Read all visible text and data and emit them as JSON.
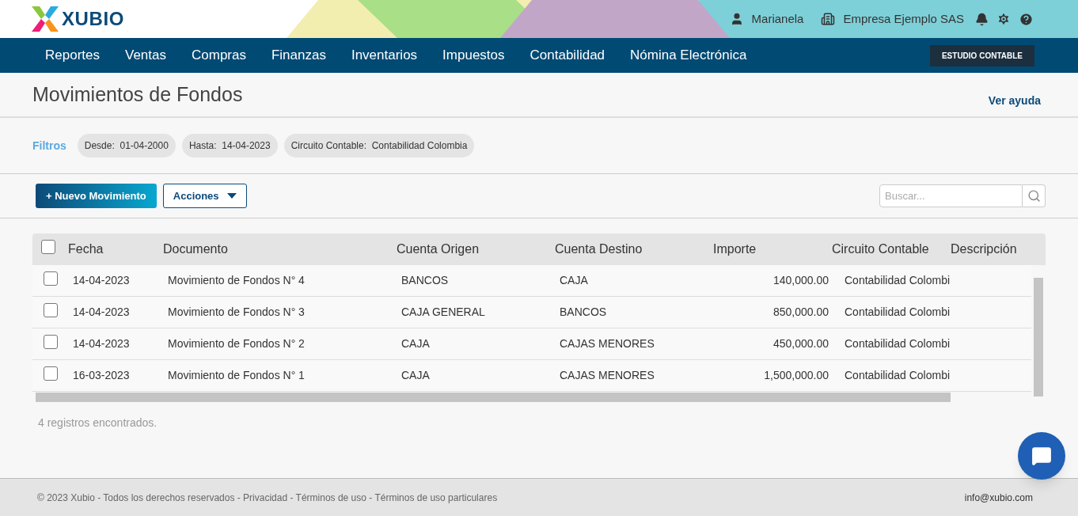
{
  "header": {
    "logo": "XUBIO",
    "user": "Marianela",
    "company": "Empresa Ejemplo SAS"
  },
  "nav": {
    "items": [
      {
        "label": "Reportes",
        "selected": false
      },
      {
        "label": "Ventas",
        "selected": false
      },
      {
        "label": "Compras",
        "selected": false
      },
      {
        "label": "Finanzas",
        "selected": false
      },
      {
        "label": "Inventarios",
        "selected": false
      },
      {
        "label": "Impuestos",
        "selected": false
      },
      {
        "label": "Contabilidad",
        "selected": false
      },
      {
        "label": "Nómina Electrónica",
        "selected": false
      }
    ],
    "badge": "ESTUDIO CONTABLE"
  },
  "page": {
    "title": "Movimientos de Fondos",
    "help_link": "Ver ayuda"
  },
  "filters": {
    "label": "Filtros",
    "chips": [
      {
        "name": "Desde:",
        "value": "01-04-2000"
      },
      {
        "name": "Hasta:",
        "value": "14-04-2023"
      },
      {
        "name": "Circuito Contable:",
        "value": "Contabilidad Colombia"
      }
    ]
  },
  "toolbar": {
    "new_button": "+ Nuevo Movimiento",
    "actions_button": "Acciones",
    "search": {
      "placeholder": "Buscar..."
    }
  },
  "table": {
    "select_all": {
      "checked": false
    },
    "columns": [
      "Fecha",
      "Documento",
      "Cuenta Origen",
      "Cuenta Destino",
      "Importe",
      "Circuito Contable",
      "Descripción"
    ],
    "rows": [
      {
        "checked": false,
        "cells": [
          "14-04-2023",
          "Movimiento de Fondos N° 4",
          "BANCOS",
          "CAJA",
          "140,000.00",
          "Contabilidad Colombi"
        ]
      },
      {
        "checked": false,
        "cells": [
          "14-04-2023",
          "Movimiento de Fondos N° 3",
          "CAJA GENERAL",
          "BANCOS",
          "850,000.00",
          "Contabilidad Colombi"
        ]
      },
      {
        "checked": false,
        "cells": [
          "14-04-2023",
          "Movimiento de Fondos N° 2",
          "CAJA",
          "CAJAS MENORES",
          "450,000.00",
          "Contabilidad Colombi"
        ]
      },
      {
        "checked": false,
        "cells": [
          "16-03-2023",
          "Movimiento de Fondos N° 1",
          "CAJA",
          "CAJAS MENORES",
          "1,500,000.00",
          "Contabilidad Colombi"
        ]
      }
    ]
  },
  "record_count": "4 registros encontrados.",
  "footer": {
    "text": "© 2023 Xubio - Todos los derechos reservados - Privacidad - Términos de uso - Términos de uso particulares",
    "email": "info@xubio.com"
  }
}
